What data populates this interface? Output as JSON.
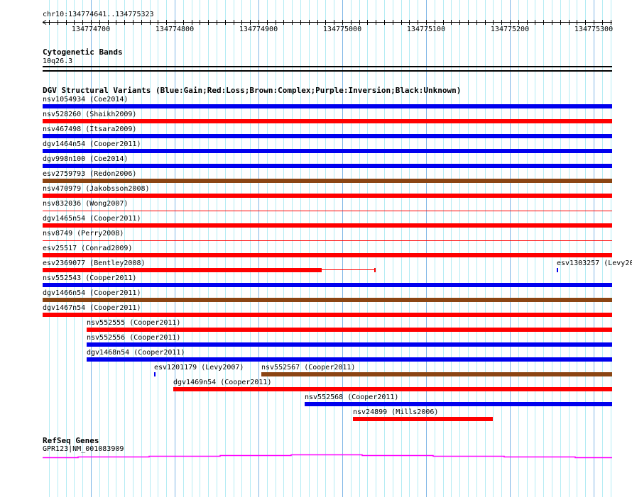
{
  "location": "chr10:134774641..134775323",
  "view": {
    "start": 134774641,
    "end": 134775323
  },
  "ruler": {
    "ticks": [
      "134774700",
      "134774800",
      "134774900",
      "134775000",
      "134775100",
      "134775200",
      "134775300"
    ]
  },
  "cytoband_track": {
    "title": "Cytogenetic Bands",
    "band": "10q26.3"
  },
  "dgv_track": {
    "title": "DGV Structural Variants (Blue:Gain;Red:Loss;Brown:Complex;Purple:Inversion;Black:Unknown)",
    "colors": {
      "gain": "#0000ee",
      "loss": "#ff0000",
      "complex": "#8b4513",
      "inversion": "#800080",
      "unknown": "#000000"
    },
    "features": [
      {
        "label": "nsv1054934 (Coe2014)",
        "type": "gain",
        "start": 134774641,
        "end": 134775323,
        "row": 0
      },
      {
        "label": "nsv528260 (Shaikh2009)",
        "type": "loss",
        "start": 134774641,
        "end": 134775323,
        "row": 1
      },
      {
        "label": "nsv467498 (Itsara2009)",
        "type": "gain",
        "start": 134774641,
        "end": 134775323,
        "row": 2
      },
      {
        "label": "dgv1464n54 (Cooper2011)",
        "type": "gain",
        "start": 134774641,
        "end": 134775323,
        "row": 3
      },
      {
        "label": "dgv998n100 (Coe2014)",
        "type": "gain",
        "start": 134774641,
        "end": 134775323,
        "row": 4
      },
      {
        "label": "esv2759793 (Redon2006)",
        "type": "complex",
        "start": 134774641,
        "end": 134775323,
        "row": 5
      },
      {
        "label": "nsv470979 (Jakobsson2008)",
        "type": "loss",
        "start": 134774641,
        "end": 134775323,
        "row": 6
      },
      {
        "label": "nsv832036 (Wong2007)",
        "type": "loss",
        "start": 134774641,
        "end": 134775323,
        "row": 7,
        "thin": true
      },
      {
        "label": "dgv1465n54 (Cooper2011)",
        "type": "loss",
        "start": 134774641,
        "end": 134775323,
        "row": 8
      },
      {
        "label": "nsv8749 (Perry2008)",
        "type": "loss",
        "start": 134774641,
        "end": 134775323,
        "row": 9,
        "thin": true
      },
      {
        "label": "esv25517 (Conrad2009)",
        "type": "loss",
        "start": 134774641,
        "end": 134775323,
        "row": 10
      },
      {
        "label": "esv2369077 (Bentley2008)",
        "type": "loss",
        "start": 134774641,
        "end": 134774975,
        "thin_end": 134775039,
        "row": 11
      },
      {
        "label": "esv1303257 (Levy20",
        "type": "gain",
        "start": 134775256,
        "end": 134775257,
        "row": 11
      },
      {
        "label": "nsv552543 (Cooper2011)",
        "type": "gain",
        "start": 134774641,
        "end": 134775323,
        "row": 12
      },
      {
        "label": "dgv1466n54 (Cooper2011)",
        "type": "complex",
        "start": 134774641,
        "end": 134775323,
        "row": 13
      },
      {
        "label": "dgv1467n54 (Cooper2011)",
        "type": "loss",
        "start": 134774641,
        "end": 134775323,
        "row": 14
      },
      {
        "label": "nsv552555 (Cooper2011)",
        "type": "loss",
        "start": 134774695,
        "end": 134775323,
        "row": 15
      },
      {
        "label": "nsv552556 (Cooper2011)",
        "type": "gain",
        "start": 134774695,
        "end": 134775323,
        "row": 16
      },
      {
        "label": "dgv1468n54 (Cooper2011)",
        "type": "gain",
        "start": 134774695,
        "end": 134775323,
        "row": 17
      },
      {
        "label": "esv1201179 (Levy2007)",
        "type": "gain",
        "start": 134774775,
        "end": 134774776,
        "row": 18
      },
      {
        "label": "nsv552567 (Cooper2011)",
        "type": "complex",
        "start": 134774903,
        "end": 134775323,
        "row": 18
      },
      {
        "label": "dgv1469n54 (Cooper2011)",
        "type": "loss",
        "start": 134774798,
        "end": 134775323,
        "row": 19
      },
      {
        "label": "nsv552568 (Cooper2011)",
        "type": "gain",
        "start": 134774955,
        "end": 134775323,
        "row": 20
      },
      {
        "label": "nsv24899 (Mills2006)",
        "type": "loss",
        "start": 134775013,
        "end": 134775180,
        "row": 21
      }
    ]
  },
  "refseq_track": {
    "title": "RefSeq Genes",
    "gene": "GPR123|NM_001083909",
    "color": "#ff00ff"
  }
}
